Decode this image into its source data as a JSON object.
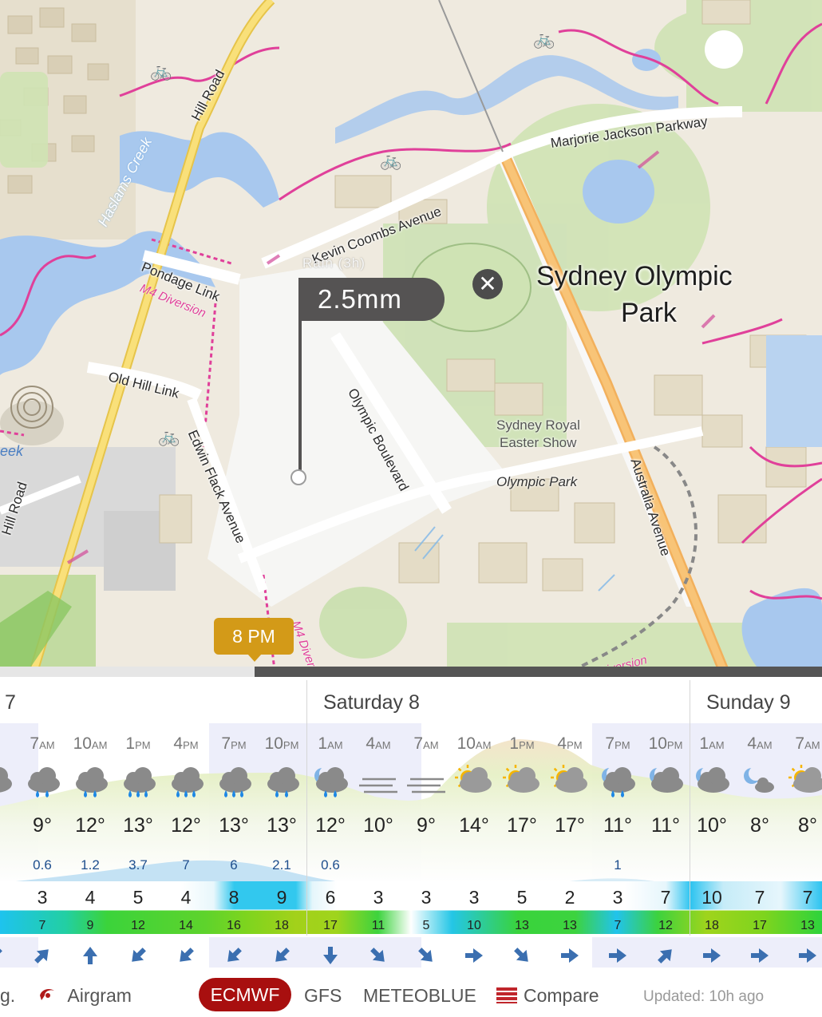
{
  "map": {
    "labels": {
      "hill_road_top": "Hill Road",
      "hill_road_bottom": "Hill Road",
      "haslams_creek": "Haslams Creek",
      "creek_fragment": "eek",
      "kevin_coombs": "Kevin Coombs Avenue",
      "marjorie_jackson": "Marjorie Jackson Parkway",
      "pondage_link": "Pondage Link",
      "m4_diversion_1": "M4 Diversion",
      "m4_diversion_2": "M4 Diver",
      "m4_diversion_3": "Diversion",
      "old_hill_link": "Old Hill Link",
      "edwin_flack": "Edwin Flack Avenue",
      "olympic_boulevard": "Olympic Boulevard",
      "australia_avenue": "Australia Avenue",
      "sydney_olympic_park_1": "Sydney Olympic",
      "sydney_olympic_park_2": "Park",
      "royal_easter_show_1": "Sydney Royal",
      "royal_easter_show_2": "Easter Show",
      "olympic_park": "Olympic Park"
    },
    "popup": {
      "caption": "Rain (3h)",
      "value": "2.5mm",
      "close_icon": "close-icon"
    },
    "timeline": {
      "time_label": "8 PM",
      "progress": 0.31
    }
  },
  "forecast": {
    "days": [
      {
        "label": "7"
      },
      {
        "label": "Saturday 8"
      },
      {
        "label": "Sunday 9"
      }
    ],
    "columns": [
      {
        "num": "",
        "ampm": "M",
        "icon": "cloud",
        "temp": "°",
        "precip": "",
        "wind": "",
        "gust": "",
        "dir": "sw"
      },
      {
        "num": "7",
        "ampm": "AM",
        "icon": "cloud-rain",
        "temp": "9°",
        "precip": "0.6",
        "wind": "3",
        "gust": "7",
        "dir": "ne"
      },
      {
        "num": "10",
        "ampm": "AM",
        "icon": "cloud-rain",
        "temp": "12°",
        "precip": "1.2",
        "wind": "4",
        "gust": "9",
        "dir": "n"
      },
      {
        "num": "1",
        "ampm": "PM",
        "icon": "cloud-rain-heavy",
        "temp": "13°",
        "precip": "3.7",
        "wind": "5",
        "gust": "12",
        "dir": "sw"
      },
      {
        "num": "4",
        "ampm": "PM",
        "icon": "cloud-rain-heavy",
        "temp": "12°",
        "precip": "7",
        "wind": "4",
        "gust": "14",
        "dir": "sw"
      },
      {
        "num": "7",
        "ampm": "PM",
        "icon": "cloud-rain-heavy",
        "temp": "13°",
        "precip": "6",
        "wind": "8",
        "gust": "16",
        "dir": "sw"
      },
      {
        "num": "10",
        "ampm": "PM",
        "icon": "cloud-rain",
        "temp": "13°",
        "precip": "2.1",
        "wind": "9",
        "gust": "18",
        "dir": "sw"
      },
      {
        "num": "1",
        "ampm": "AM",
        "icon": "moon-cloud-rain",
        "temp": "12°",
        "precip": "0.6",
        "wind": "6",
        "gust": "17",
        "dir": "s"
      },
      {
        "num": "4",
        "ampm": "AM",
        "icon": "fog",
        "temp": "10°",
        "precip": "",
        "wind": "3",
        "gust": "11",
        "dir": "se"
      },
      {
        "num": "7",
        "ampm": "AM",
        "icon": "fog",
        "temp": "9°",
        "precip": "",
        "wind": "3",
        "gust": "5",
        "dir": "se"
      },
      {
        "num": "10",
        "ampm": "AM",
        "icon": "sun-cloud",
        "temp": "14°",
        "precip": "",
        "wind": "3",
        "gust": "10",
        "dir": "e"
      },
      {
        "num": "1",
        "ampm": "PM",
        "icon": "sun-cloud",
        "temp": "17°",
        "precip": "",
        "wind": "5",
        "gust": "13",
        "dir": "se"
      },
      {
        "num": "4",
        "ampm": "PM",
        "icon": "sun-cloud",
        "temp": "17°",
        "precip": "",
        "wind": "2",
        "gust": "13",
        "dir": "e"
      },
      {
        "num": "7",
        "ampm": "PM",
        "icon": "moon-cloud-rain",
        "temp": "11°",
        "precip": "1",
        "wind": "3",
        "gust": "7",
        "dir": "e"
      },
      {
        "num": "10",
        "ampm": "PM",
        "icon": "moon-cloud",
        "temp": "11°",
        "precip": "",
        "wind": "7",
        "gust": "12",
        "dir": "ne"
      },
      {
        "num": "1",
        "ampm": "AM",
        "icon": "moon-cloud",
        "temp": "10°",
        "precip": "",
        "wind": "10",
        "gust": "18",
        "dir": "e"
      },
      {
        "num": "4",
        "ampm": "AM",
        "icon": "moon-cloud-small",
        "temp": "8°",
        "precip": "",
        "wind": "7",
        "gust": "17",
        "dir": "e"
      },
      {
        "num": "7",
        "ampm": "AM",
        "icon": "sun-cloud",
        "temp": "8°",
        "precip": "",
        "wind": "7",
        "gust": "13",
        "dir": "e"
      }
    ]
  },
  "footer": {
    "fragment": "g.",
    "airgram": "Airgram",
    "airgram_icon": "airgram-icon",
    "models": [
      "ECMWF",
      "GFS",
      "METEOBLUE"
    ],
    "selected_model": "ECMWF",
    "compare": "Compare",
    "compare_icon": "compare-icon",
    "updated": "Updated: 10h ago"
  },
  "colors": {
    "popup_bg": "#555353",
    "time_bubble": "#d39a18",
    "selected_model_bg": "#a80f0f",
    "precip_text": "#1f4f8e",
    "bike_path": "#e0409a",
    "main_road": "#f6cd3a",
    "australia_ave": "#f5b463",
    "water": "#a8c8ee"
  }
}
